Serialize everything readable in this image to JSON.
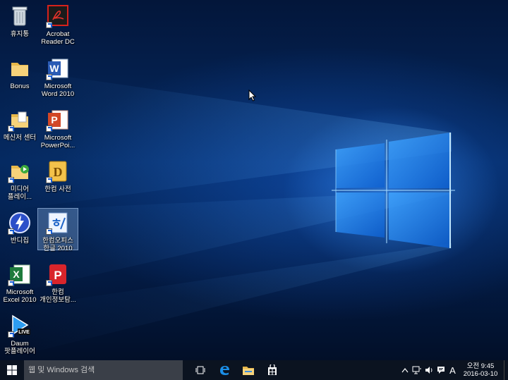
{
  "desktop": {
    "icons": [
      {
        "label": "휴지통",
        "icon": "recycle-bin-icon"
      },
      {
        "label": "Acrobat\nReader DC",
        "icon": "acrobat-icon"
      },
      {
        "label": "Bonus",
        "icon": "folder-icon"
      },
      {
        "label": "Microsoft\nWord 2010",
        "icon": "word-icon"
      },
      {
        "label": "메신저 센터",
        "icon": "folder-shortcut-icon"
      },
      {
        "label": "Microsoft\nPowerPoi...",
        "icon": "powerpoint-icon"
      },
      {
        "label": "미디어\n플레이...",
        "icon": "media-folder-icon"
      },
      {
        "label": "한컴 사전",
        "icon": "hancom-dictionary-icon"
      },
      {
        "label": "반디집",
        "icon": "bandizip-icon"
      },
      {
        "label": "한컴오피스\n한글 2010",
        "icon": "hwp-icon"
      },
      {
        "label": "Microsoft\nExcel 2010",
        "icon": "excel-icon"
      },
      {
        "label": "한컴\n개인정보탐...",
        "icon": "hancom-privacy-icon"
      },
      {
        "label": "Daum\n팟플레이어",
        "icon": "potplayer-icon"
      }
    ],
    "selected": "한컴오피스 한글 2010"
  },
  "taskbar": {
    "search_placeholder": "웹 및 Windows 검색",
    "pinned": [
      "task-view-icon",
      "edge-icon",
      "file-explorer-icon",
      "store-icon"
    ],
    "tray": {
      "ime_label": "A",
      "time": "오전 9:45",
      "date": "2016-03-10"
    }
  },
  "colors": {
    "taskbar_bg": "#0b1320",
    "search_bg": "#3a3f48",
    "wallpaper_glow": "#3c96ff"
  }
}
